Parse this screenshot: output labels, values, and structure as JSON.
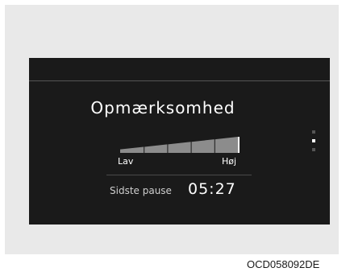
{
  "screen": {
    "title": "Opmærksomhed",
    "attention_level": {
      "segments": 5,
      "low_label": "Lav",
      "high_label": "Høj"
    },
    "last_pause": {
      "label": "Sidste pause",
      "value": "05:27"
    },
    "pagination": {
      "pages": 3,
      "current_page": 2
    }
  },
  "figure": {
    "reference_code": "OCD058092DE"
  },
  "colors": {
    "screen_background": "#1a1a1a",
    "panel_background": "#e9e9e9",
    "text": "#ffffff",
    "meter_fill": "#8c8c8c"
  }
}
